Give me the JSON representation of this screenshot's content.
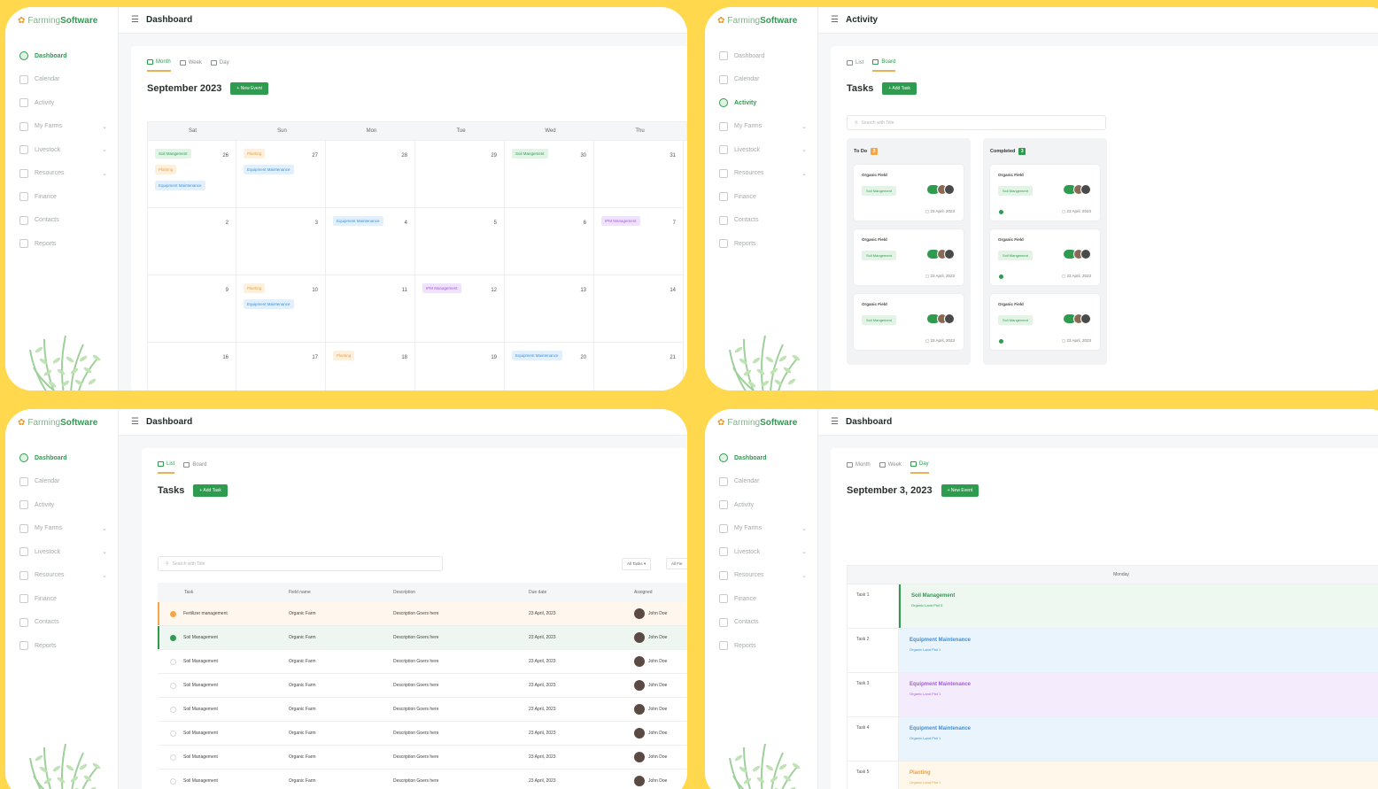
{
  "brand": {
    "name_light": "Farming",
    "name_bold": "Software"
  },
  "nav_items": [
    "Dashboard",
    "Calendar",
    "Activity",
    "My Farms",
    "Livestock",
    "Resources",
    "Finance",
    "Contacts",
    "Reports"
  ],
  "panel1": {
    "title": "Dashboard",
    "tabs": [
      "Month",
      "Week",
      "Day"
    ],
    "heading": "September 2023",
    "new_event": "+ New Event",
    "days": [
      "Sat",
      "Sun",
      "Mon",
      "Tue",
      "Wed",
      "Thu"
    ],
    "rows": [
      {
        "nums": [
          "26",
          "27",
          "28",
          "29",
          "30",
          "31"
        ],
        "chips": [
          [
            {
              "t": "Soil Mangement",
              "c": "green"
            },
            {
              "t": "Planting",
              "c": "orange"
            },
            {
              "t": "Equipment Maintenance",
              "c": "blue"
            }
          ],
          [
            {
              "t": "Planting",
              "c": "orange"
            },
            {
              "t": "Equipment Maintenance",
              "c": "blue"
            }
          ],
          [],
          [],
          [
            {
              "t": "Soil Mangement",
              "c": "green"
            }
          ],
          []
        ]
      },
      {
        "nums": [
          "2",
          "3",
          "4",
          "5",
          "6",
          "7"
        ],
        "chips": [
          [],
          [],
          [
            {
              "t": "Equipment Maintenance",
              "c": "blue"
            }
          ],
          [],
          [],
          [
            {
              "t": "IPM Management",
              "c": "purple"
            }
          ]
        ]
      },
      {
        "nums": [
          "9",
          "10",
          "11",
          "12",
          "13",
          "14"
        ],
        "chips": [
          [],
          [
            {
              "t": "Planting",
              "c": "orange"
            },
            {
              "t": "Equipment Maintenance",
              "c": "blue"
            }
          ],
          [],
          [
            {
              "t": "IPM Management",
              "c": "purple"
            }
          ],
          [],
          []
        ]
      },
      {
        "nums": [
          "16",
          "17",
          "18",
          "19",
          "20",
          "21"
        ],
        "chips": [
          [],
          [],
          [
            {
              "t": "Planting",
              "c": "orange"
            }
          ],
          [],
          [
            {
              "t": "Equipment Maintenance",
              "c": "blue"
            }
          ],
          []
        ]
      }
    ]
  },
  "panel2": {
    "title": "Activity",
    "tabs": [
      "List",
      "Board"
    ],
    "heading": "Tasks",
    "add_task": "+ Add Task",
    "search_placeholder": "Search with Title",
    "columns": [
      {
        "name": "To Do",
        "count": "3",
        "color": "#F2A84A"
      },
      {
        "name": "Completed",
        "count": "3",
        "color": "#2E9B4F"
      }
    ],
    "card": {
      "title": "Organic Field",
      "chip": "Soil Mangement",
      "date": "23 April, 2023"
    }
  },
  "panel3": {
    "title": "Dashboard",
    "tabs": [
      "List",
      "Board"
    ],
    "heading": "Tasks",
    "add_task": "+ Add Task",
    "search_placeholder": "Search with Title",
    "filter1": "All Tasks",
    "filter2": "All Fie",
    "headers": [
      "Task",
      "Field name",
      "Description",
      "Due date",
      "Assigned"
    ],
    "rows": [
      {
        "task": "Fertilizer management",
        "field": "Organic Farm",
        "desc": "Description Goers here",
        "due": "23 April, 2023",
        "who": "John Doe",
        "state": "orange"
      },
      {
        "task": "Soil Management",
        "field": "Organic Farm",
        "desc": "Description Goers here",
        "due": "23 April, 2023",
        "who": "John Doe",
        "state": "green"
      },
      {
        "task": "Soil Management",
        "field": "Organic Farm",
        "desc": "Description Goers here",
        "due": "23 April, 2023",
        "who": "John Doe",
        "state": "none"
      },
      {
        "task": "Soil Management",
        "field": "Organic Farm",
        "desc": "Description Goers here",
        "due": "23 April, 2023",
        "who": "John Doe",
        "state": "none"
      },
      {
        "task": "Soil Management",
        "field": "Organic Farm",
        "desc": "Description Goers here",
        "due": "23 April, 2023",
        "who": "John Doe",
        "state": "none"
      },
      {
        "task": "Soil Management",
        "field": "Organic Farm",
        "desc": "Description Goers here",
        "due": "23 April, 2023",
        "who": "John Doe",
        "state": "none"
      },
      {
        "task": "Soil Management",
        "field": "Organic Farm",
        "desc": "Description Goers here",
        "due": "23 April, 2023",
        "who": "John Doe",
        "state": "none"
      },
      {
        "task": "Soil Management",
        "field": "Organic Farm",
        "desc": "Description Goers here",
        "due": "23 April, 2023",
        "who": "John Doe",
        "state": "none"
      }
    ]
  },
  "panel4": {
    "title": "Dashboard",
    "tabs": [
      "Month",
      "Week",
      "Day"
    ],
    "heading": "September 3, 2023",
    "new_event": "+ New Event",
    "day": "Monday",
    "rows": [
      {
        "label": "Task 1",
        "title": "Soil Management",
        "sub": "Organic Land Plot 5",
        "bg": "#EEF8F0",
        "fg": "#2E9B4F",
        "bar": "#2E9B4F"
      },
      {
        "label": "Task 2",
        "title": "Equipment Maintenance",
        "sub": "Organic Land Plot 1",
        "bg": "#EAF4FC",
        "fg": "#3D8FD8",
        "bar": ""
      },
      {
        "label": "Task 3",
        "title": "Equipment Maintenance",
        "sub": "Organic Land Plot 1",
        "bg": "#F4EBFC",
        "fg": "#A35CE0",
        "bar": ""
      },
      {
        "label": "Task 4",
        "title": "Equipment Maintenance",
        "sub": "Organic Land Plot 1",
        "bg": "#EAF4FC",
        "fg": "#3D8FD8",
        "bar": ""
      },
      {
        "label": "Task 5",
        "title": "Planting",
        "sub": "Organic Land Plot 1",
        "bg": "#FEF7EA",
        "fg": "#E7A24A",
        "bar": ""
      }
    ]
  }
}
